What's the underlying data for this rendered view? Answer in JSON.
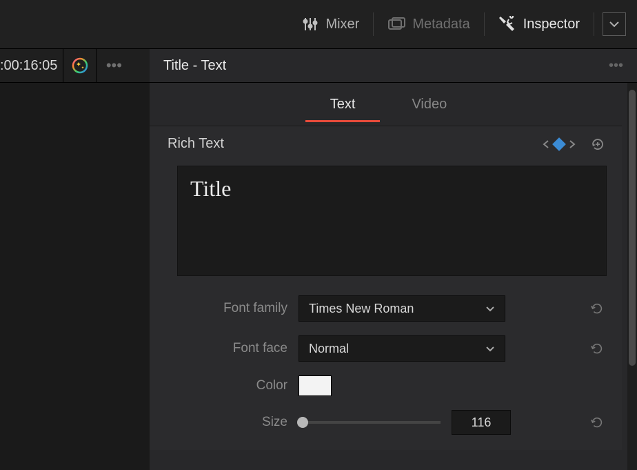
{
  "topbar": {
    "mixer_label": "Mixer",
    "metadata_label": "Metadata",
    "inspector_label": "Inspector"
  },
  "timeline": {
    "timecode": ":00:16:05"
  },
  "header": {
    "title": "Title - Text"
  },
  "tabs": {
    "text_label": "Text",
    "video_label": "Video",
    "active": "text"
  },
  "section": {
    "rich_text_label": "Rich Text"
  },
  "text_content": "Title",
  "controls": {
    "font_family": {
      "label": "Font family",
      "value": "Times New Roman"
    },
    "font_face": {
      "label": "Font face",
      "value": "Normal"
    },
    "color": {
      "label": "Color",
      "value": "#f3f3f3"
    },
    "size": {
      "label": "Size",
      "value": "116"
    }
  }
}
